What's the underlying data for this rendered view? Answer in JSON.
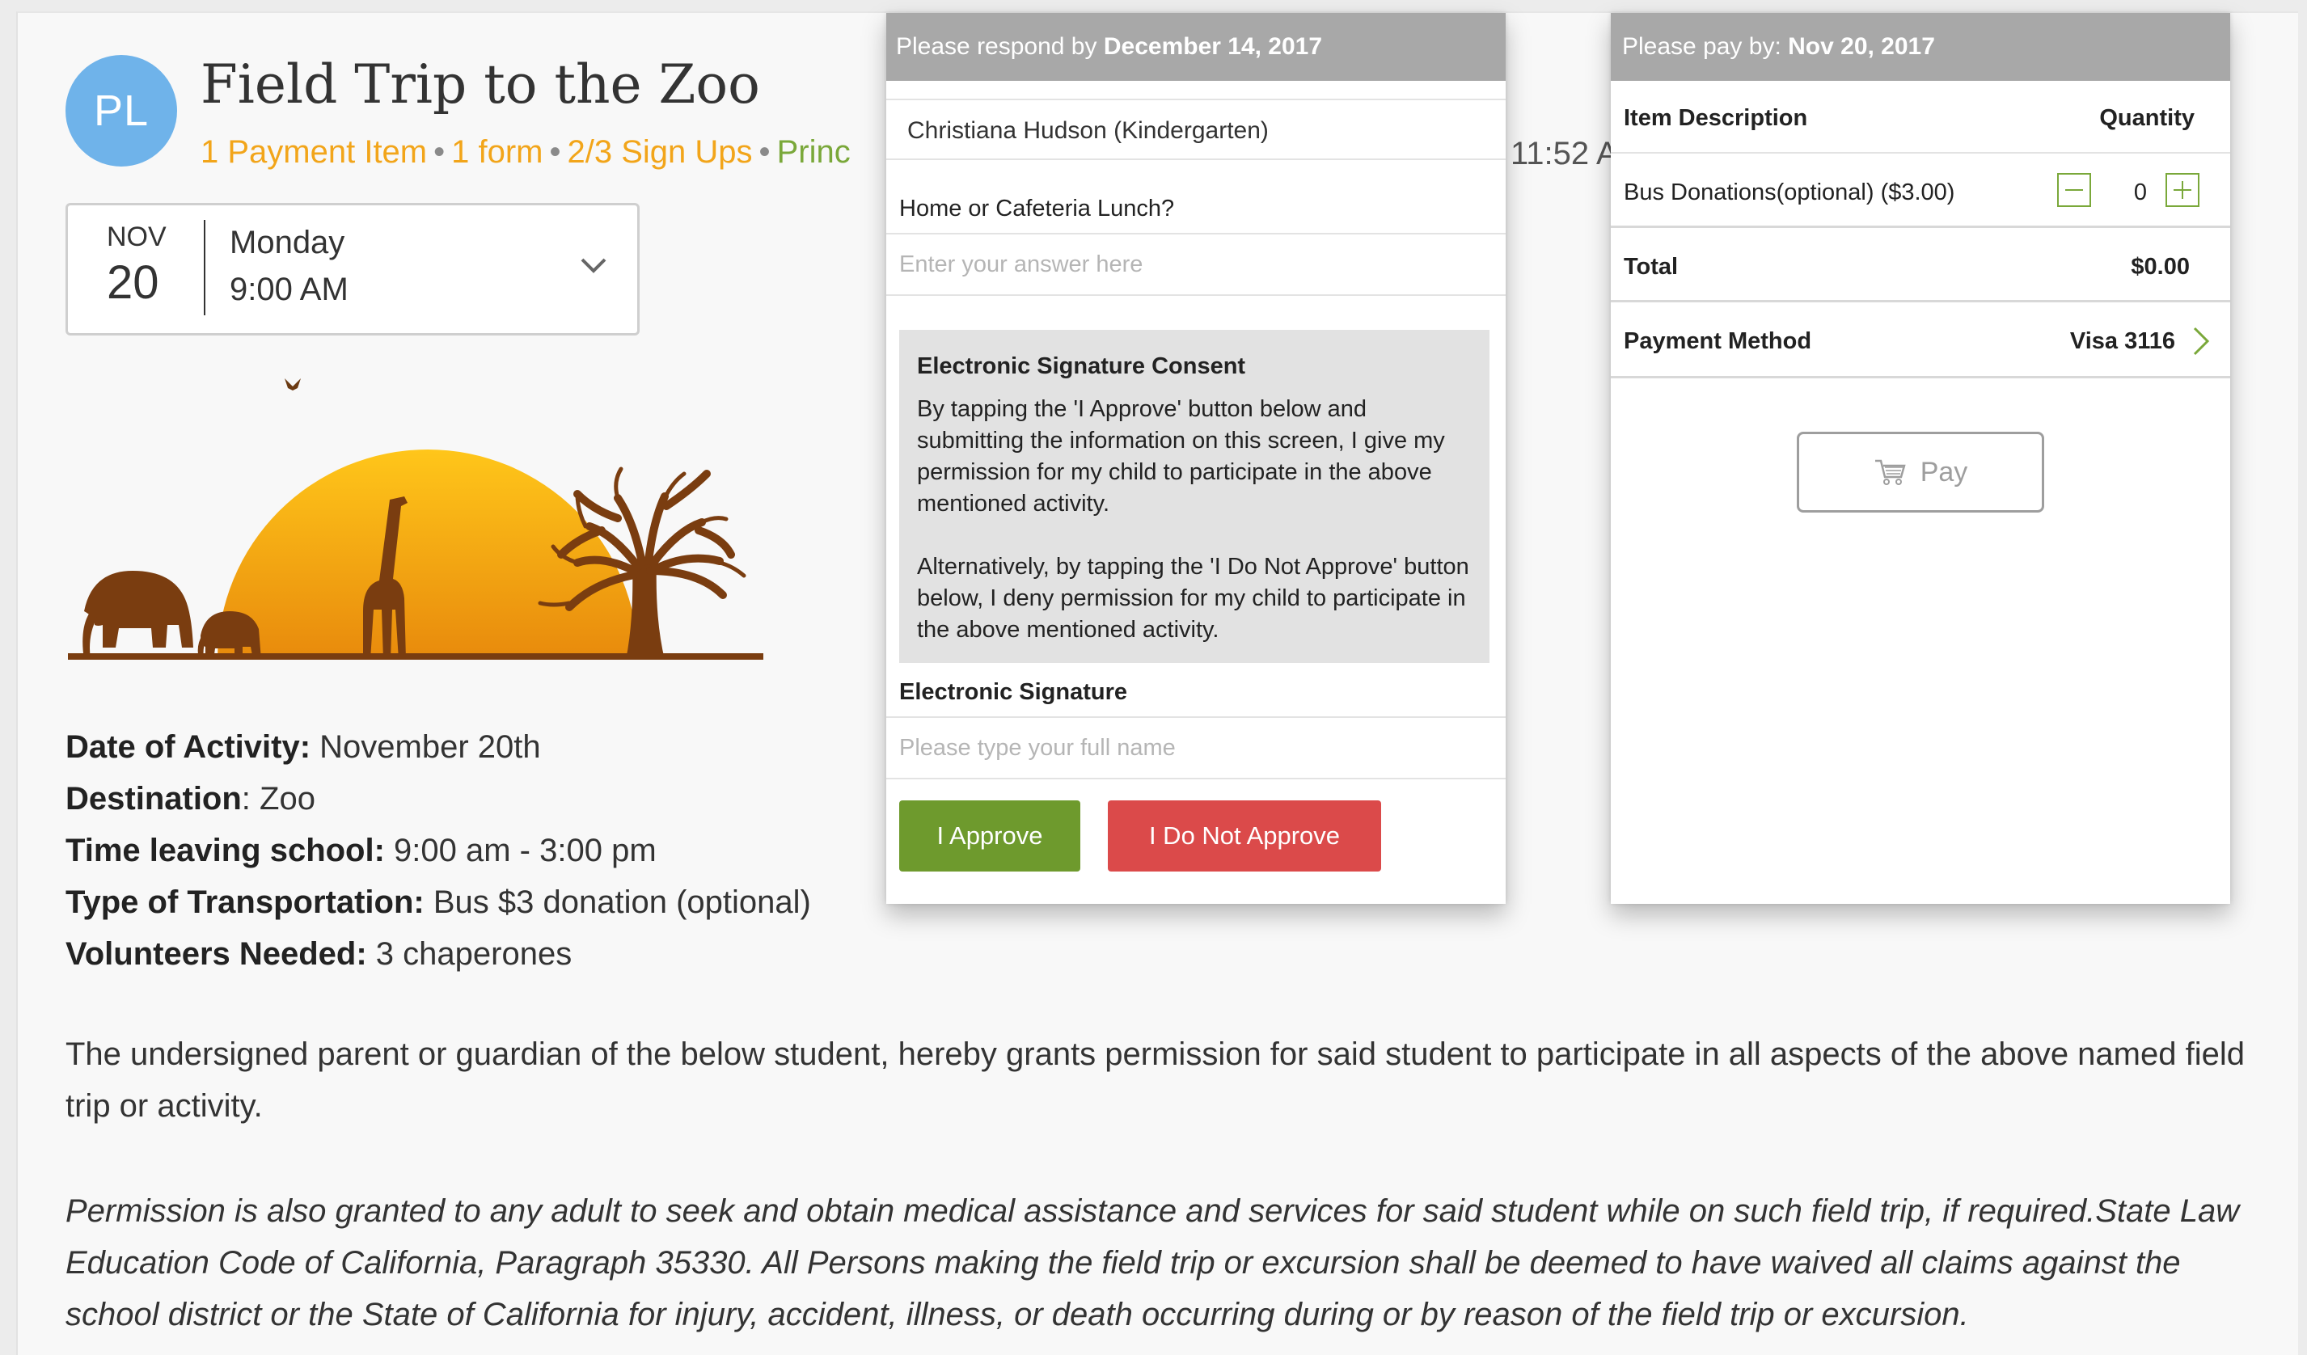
{
  "event": {
    "avatar_initials": "PL",
    "title": "Field Trip to the Zoo",
    "meta": {
      "payment_items": "1 Payment Item",
      "forms": "1 form",
      "signups": "2/3 Sign Ups",
      "principal": "Princ",
      "time_fragment": "11:52 A"
    },
    "date": {
      "month": "NOV",
      "day": "20",
      "weekday": "Monday",
      "time": "9:00 AM"
    }
  },
  "details": [
    {
      "label": "Date of Activity:",
      "value": " November 20th"
    },
    {
      "label": "Destination",
      "value": ": Zoo"
    },
    {
      "label": "Time leaving school:",
      "value": " 9:00 am - 3:00 pm"
    },
    {
      "label": "Type of Transportation:",
      "value": " Bus $3 donation (optional)"
    },
    {
      "label": "Volunteers Needed:",
      "value": " 3 chaperones"
    }
  ],
  "paragraphs": {
    "grant": "The undersigned parent or guardian of the below student, hereby grants permission for said student to participate in all aspects of the above named field trip or activity.",
    "medical": "Permission is also granted to any adult to seek and obtain medical assistance and services for said student while on such field trip, if required.State Law Education Code of California, Paragraph 35330. All Persons making the field trip or excursion shall be deemed to have waived all claims against the school district or the State of California for injury, accident, illness, or death occurring during or by reason of the field trip or excursion."
  },
  "form_panel": {
    "respond_prefix": "Please respond by ",
    "respond_date": "December 14, 2017",
    "student": "Christiana Hudson (Kindergarten)",
    "question": "Home or Cafeteria Lunch?",
    "answer_placeholder": "Enter your answer here",
    "consent_title": "Electronic Signature Consent",
    "consent_p1": "By tapping the 'I Approve' button below and submitting the information on this screen, I give my permission for my child to participate in the above mentioned activity.",
    "consent_p2": "Alternatively, by tapping the 'I Do Not Approve' button below, I deny permission for my child to participate in the above mentioned activity.",
    "signature_label": "Electronic Signature",
    "signature_placeholder": "Please type your full name",
    "approve_label": "I Approve",
    "deny_label": "I Do Not Approve",
    "approve_color": "#6e9a2d",
    "deny_color": "#db4a4a"
  },
  "payment_panel": {
    "pay_by_prefix": "Please pay by: ",
    "pay_by_date": "Nov 20, 2017",
    "col_item": "Item Description",
    "col_qty": "Quantity",
    "item_label": "Bus Donations(optional) ($3.00)",
    "item_qty": "0",
    "total_label": "Total",
    "total_value": "$0.00",
    "method_label": "Payment Method",
    "method_value": "Visa 3116",
    "pay_label": "Pay",
    "accent": "#7aa83a"
  }
}
